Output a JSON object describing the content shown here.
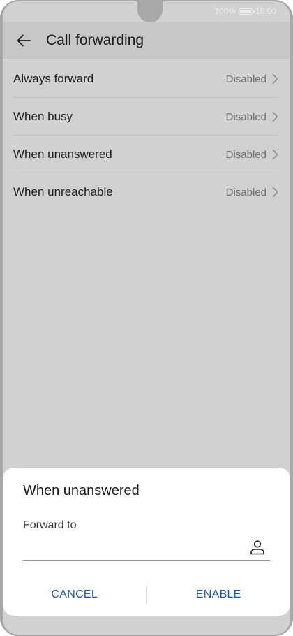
{
  "status_bar": {
    "battery": "100%",
    "time": "10:00"
  },
  "header": {
    "title": "Call forwarding",
    "back_icon": "arrow-left-icon"
  },
  "list": {
    "items": [
      {
        "label": "Always forward",
        "value": "Disabled"
      },
      {
        "label": "When busy",
        "value": "Disabled"
      },
      {
        "label": "When unanswered",
        "value": "Disabled"
      },
      {
        "label": "When unreachable",
        "value": "Disabled"
      }
    ]
  },
  "dialog": {
    "title": "When unanswered",
    "field_label": "Forward to",
    "field_value": "",
    "contact_icon": "person-icon",
    "cancel_label": "CANCEL",
    "enable_label": "ENABLE"
  },
  "colors": {
    "accent": "#1a5aa6",
    "overlay": "#d1d1d1",
    "dialog_bg": "#ffffff"
  }
}
